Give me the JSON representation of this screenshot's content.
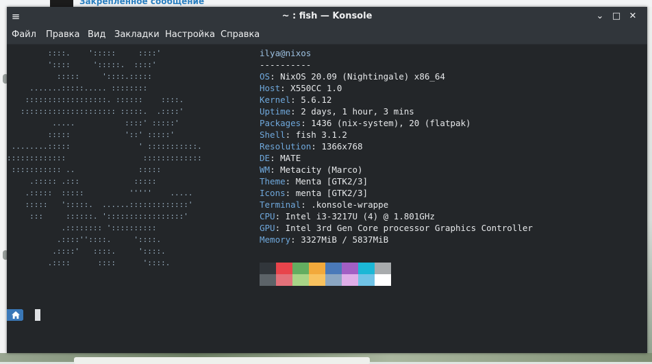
{
  "background": {
    "pinned_message": "Закрепленное сообщение"
  },
  "window": {
    "title": "~ : fish — Konsole",
    "buttons": {
      "minimize": "⌄",
      "maximize": "□",
      "close": "✕"
    }
  },
  "menubar": {
    "items": [
      "Файл",
      "Правка",
      "Вид",
      "Закладки",
      "Настройка",
      "Справка"
    ]
  },
  "neofetch": {
    "logo": "         ::::.    ':::::     ::::'\n         '::::     ':::::.  ::::'\n           :::::     '::::.:::::\n     .......:::::..... ::::::::\n    ::::::::::::::::::. ::::::    ::::.\n   ::::::::::::::::::::: :::::.  .::::'\n          .....           ::::' :::::'\n         :::::            '::' :::::'\n ........:::::               ' :::::::::::.\n:::::::::::::                 :::::::::::::\n ::::::::::: ..              :::::\n     .::::: .:::            :::::\n    .:::::  :::::          '''''    .....\n    :::::   ':::::.  ......:::::::::::::'\n     :::     ::::::. ':::::::::::::::::'\n            .:::::::: '::::::::::\n           .::::''::::.     '::::.\n          .::::'   ::::.     '::::.\n         .::::      ::::      '::::.",
    "user": "ilya",
    "at": "@",
    "host": "nixos",
    "separator": "----------",
    "fields": [
      {
        "key": "OS",
        "value": "NixOS 20.09 (Nightingale) x86_64"
      },
      {
        "key": "Host",
        "value": "X550CC 1.0"
      },
      {
        "key": "Kernel",
        "value": "5.6.12"
      },
      {
        "key": "Uptime",
        "value": "2 days, 1 hour, 3 mins"
      },
      {
        "key": "Packages",
        "value": "1436 (nix-system), 20 (flatpak)"
      },
      {
        "key": "Shell",
        "value": "fish 3.1.2"
      },
      {
        "key": "Resolution",
        "value": "1366x768"
      },
      {
        "key": "DE",
        "value": "MATE"
      },
      {
        "key": "WM",
        "value": "Metacity (Marco)"
      },
      {
        "key": "Theme",
        "value": "Menta [GTK2/3]"
      },
      {
        "key": "Icons",
        "value": "menta [GTK2/3]"
      },
      {
        "key": "Terminal",
        "value": ".konsole-wrappe"
      },
      {
        "key": "CPU",
        "value": "Intel i3-3217U (4) @ 1.801GHz"
      },
      {
        "key": "GPU",
        "value": "Intel 3rd Gen Core processor Graphics Controller"
      },
      {
        "key": "Memory",
        "value": "3327MiB / 5837MiB"
      }
    ],
    "key_separator": ": ",
    "palette": {
      "normal": [
        "#232627",
        "#ed1515",
        "#11d116",
        "#f67400",
        "#1d99f3",
        "#9b59b6",
        "#1abc9c",
        "#c0c0c0"
      ],
      "bright": [
        "#7f8c8d",
        "#c0392b",
        "#1cdc9a",
        "#fdbc4b",
        "#3daee9",
        "#8e44ad",
        "#16a085",
        "#ffffff"
      ]
    },
    "palette_display": {
      "normal": [
        "#31363b",
        "#e8444b",
        "#63ad60",
        "#f2a93b",
        "#4a79b9",
        "#a25fc4",
        "#1bb7d6",
        "#a8abad"
      ],
      "bright": [
        "#5c6368",
        "#e3717a",
        "#a8d487",
        "#f8c25f",
        "#8ba6c2",
        "#e0aee8",
        "#70c3e6",
        "#ffffff"
      ]
    }
  },
  "prompt": {
    "icon": "home-icon",
    "color": "#3a78b8"
  }
}
